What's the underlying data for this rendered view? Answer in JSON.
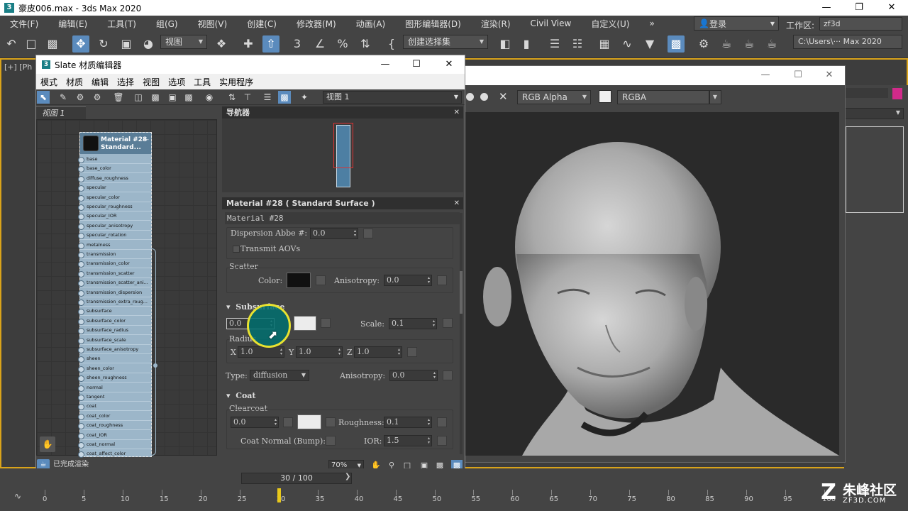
{
  "app": {
    "title": "豪皮006.max - 3ds Max 2020",
    "icon": "3"
  },
  "main_menu": [
    "文件(F)",
    "编辑(E)",
    "工具(T)",
    "组(G)",
    "视图(V)",
    "创建(C)",
    "修改器(M)",
    "动画(A)",
    "图形编辑器(D)",
    "渲染(R)",
    "Civil View",
    "自定义(U)",
    "»"
  ],
  "login": "登录",
  "workspace": {
    "label": "工作区:",
    "value": "zf3d"
  },
  "toolbar": {
    "view_dropdown": "视图",
    "selection_set": "创建选择集",
    "path": "C:\\Users\\··· Max 2020"
  },
  "viewport_label": "[+] [Ph",
  "slate": {
    "title": "Slate 材质编辑器",
    "menu": [
      "模式",
      "材质",
      "编辑",
      "选择",
      "视图",
      "选项",
      "工具",
      "实用程序"
    ],
    "view_dropdown": "视图 1",
    "view_tab": "视图 1",
    "status": "已完成渲染",
    "zoom": "70%",
    "node": {
      "title1": "Material #28",
      "title2": "Standard...",
      "slots": [
        "base",
        "base_color",
        "diffuse_roughness",
        "specular",
        "specular_color",
        "specular_roughness",
        "specular_IOR",
        "specular_anisotropy",
        "specular_rotation",
        "metalness",
        "transmission",
        "transmission_color",
        "transmission_scatter",
        "transmission_scatter_ani...",
        "transmission_dispersion",
        "transmission_extra_roug...",
        "subsurface",
        "subsurface_color",
        "subsurface_radius",
        "subsurface_scale",
        "subsurface_anisotropy",
        "sheen",
        "sheen_color",
        "sheen_roughness",
        "normal",
        "tangent",
        "coat",
        "coat_color",
        "coat_roughness",
        "coat_IOR",
        "coat_normal",
        "coat_affect_color"
      ]
    },
    "navigator_title": "导航器",
    "params": {
      "header": "Material #28  ( Standard Surface )",
      "name": "Material #28",
      "dispersion_label": "Dispersion Abbe #:",
      "dispersion_value": "0.0",
      "transmit_aovs": "Transmit AOVs",
      "scatter_label": "Scatter",
      "color_label": "Color:",
      "anisotropy_label": "Anisotropy:",
      "scatter_aniso_value": "0.0",
      "subsurface_label": "Subsurface",
      "subsurface_value": "0.0",
      "scale_label": "Scale:",
      "scale_value": "0.1",
      "radius_label": "Radius",
      "rx_label": "X",
      "rx_value": "1.0",
      "ry_label": "Y",
      "ry_value": "1.0",
      "rz_label": "Z",
      "rz_value": "1.0",
      "type_label": "Type:",
      "type_value": "diffusion",
      "type_aniso_label": "Anisotropy:",
      "type_aniso_value": "0.0",
      "coat_label": "Coat",
      "clearcoat_label": "Clearcoat",
      "coat_value": "0.0",
      "roughness_label": "Roughness:",
      "roughness_value": "0.1",
      "coat_normal_label": "Coat Normal (Bump):",
      "ior_label": "IOR:",
      "ior_value": "1.5"
    }
  },
  "render_window": {
    "channel": "RGB Alpha",
    "mode": "RGBA"
  },
  "timeline": {
    "slider": "30 / 100",
    "ticks": [
      "0",
      "5",
      "10",
      "15",
      "20",
      "25",
      "30",
      "35",
      "40",
      "45",
      "50",
      "55",
      "60",
      "65",
      "70",
      "75",
      "80",
      "85",
      "90",
      "95",
      "100"
    ],
    "current_frame": 30
  },
  "watermark": {
    "cn": "朱峰社区",
    "en": "ZF3D.COM",
    "logo": "Z"
  }
}
